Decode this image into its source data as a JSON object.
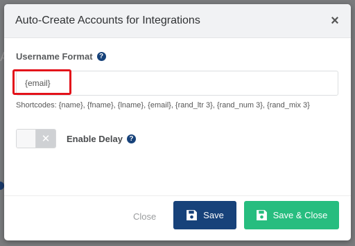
{
  "background": {
    "partial_glyph": "A"
  },
  "modal": {
    "title": "Auto-Create Accounts for Integrations",
    "close_glyph": "×"
  },
  "username": {
    "label": "Username Format",
    "value": "{email}",
    "shortcodes": "Shortcodes: {name}, {fname}, {lname}, {email}, {rand_ltr 3}, {rand_num 3}, {rand_mix 3}"
  },
  "delay": {
    "label": "Enable Delay",
    "toggle_glyph": "✕",
    "enabled": false
  },
  "footer": {
    "close_label": "Close",
    "save_label": "Save",
    "save_close_label": "Save & Close"
  },
  "help_glyph": "?",
  "colors": {
    "primary": "#17427a",
    "success": "#27bd7f",
    "highlight": "#e3111a"
  }
}
